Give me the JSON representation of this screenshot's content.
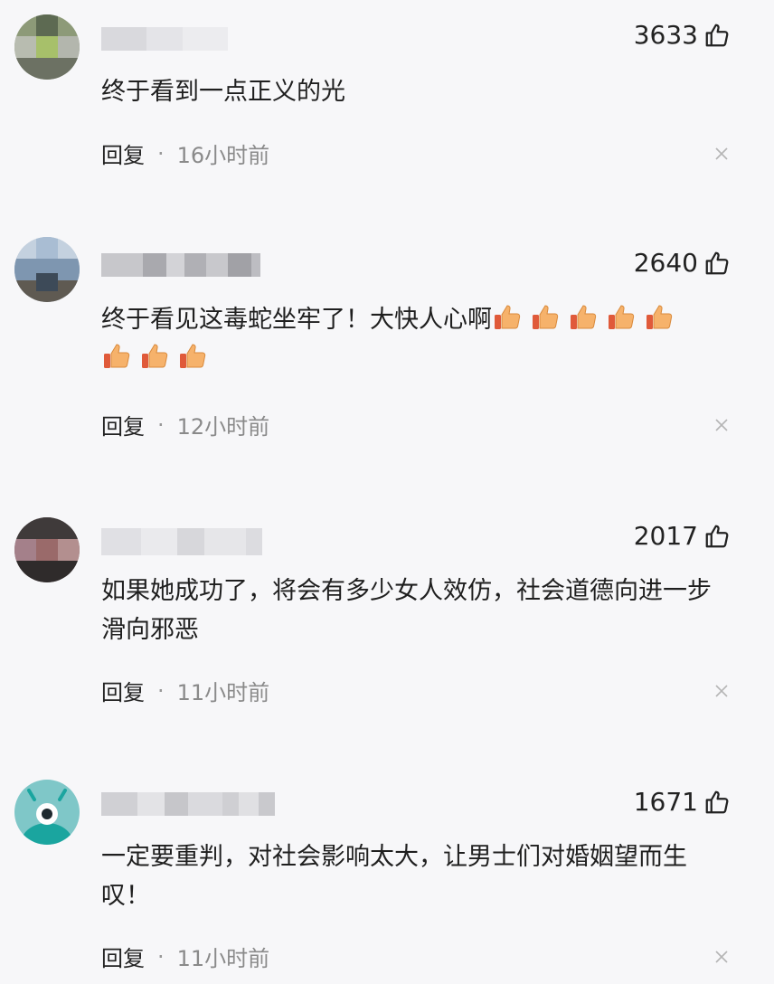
{
  "comments": [
    {
      "likes": "3633",
      "text": "终于看到一点正义的光",
      "emojis": 0,
      "reply_label": "回复",
      "separator": "·",
      "time": "16小时前"
    },
    {
      "likes": "2640",
      "text": "终于看见这毒蛇坐牢了！大快人心啊",
      "emojis": 8,
      "reply_label": "回复",
      "separator": "·",
      "time": "12小时前"
    },
    {
      "likes": "2017",
      "text": "如果她成功了，将会有多少女人效仿，社会道德向进一步滑向邪恶",
      "emojis": 0,
      "reply_label": "回复",
      "separator": "·",
      "time": "11小时前"
    },
    {
      "likes": "1671",
      "text": "一定要重判，对社会影响太大，让男士们对婚姻望而生叹！",
      "emojis": 0,
      "reply_label": "回复",
      "separator": "·",
      "time": "11小时前"
    }
  ],
  "icons": {
    "like": "thumbs-up-outline-icon",
    "emoji": "thumbs-up-emoji-icon",
    "close": "close-icon"
  },
  "colors": {
    "background": "#f7f7f9",
    "text": "#1f1f1f",
    "meta": "#8a8a8a",
    "emoji_fill": "#f6b26b"
  }
}
